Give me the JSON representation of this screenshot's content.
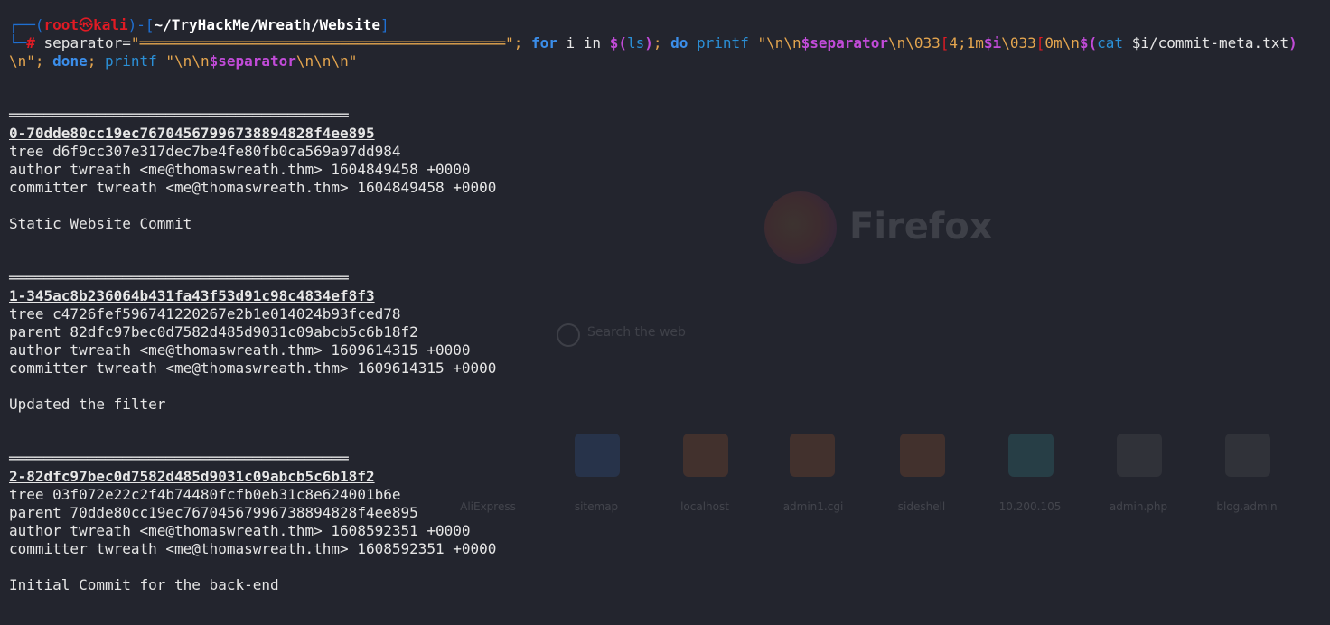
{
  "prompt": {
    "corner_top": "┌──(",
    "user": "root",
    "at_symbol": "㉿",
    "host": "kali",
    "mid": ")-[",
    "path": "~/TryHackMe/Wreath/Website",
    "close": "]",
    "corner_bottom": "└─",
    "hash": "#"
  },
  "command": {
    "part1": " separator=",
    "sep_string": "\"══════════════════════════════════════════\"",
    "semi1": "; ",
    "for_kw": "for",
    "i_in": " i in ",
    "sub_open": "$(",
    "ls": "ls",
    "sub_close": ")",
    "semi2": "; ",
    "do_kw": "do",
    "printf1": " printf ",
    "str1": "\"\\n\\n",
    "var_sep": "$separator",
    "str2": "\\n\\033",
    "bracket": "[",
    "str3": "4;1m",
    "var_i": "$i",
    "str4": "\\033",
    "bracket2": "[",
    "str5": "0m\\n",
    "sub2_open": "$(",
    "cat": "cat",
    "cat_arg": " $i/commit-meta.txt",
    "sub2_close": ")",
    "line2_str": "\\n\"",
    "semi3": "; ",
    "done_kw": "done",
    "semi4": ";",
    "printf2": " printf ",
    "str6": "\"\\n\\n",
    "var_sep2": "$separator",
    "str7": "\\n\\n\\n\""
  },
  "separator": "═══════════════════════════════════════",
  "commits": [
    {
      "header": "0-70dde80cc19ec76704567996738894828f4ee895",
      "lines": [
        "tree d6f9cc307e317dec7be4fe80fb0ca569a97dd984",
        "author twreath <me@thomaswreath.thm> 1604849458 +0000",
        "committer twreath <me@thomaswreath.thm> 1604849458 +0000"
      ],
      "message": "Static Website Commit"
    },
    {
      "header": "1-345ac8b236064b431fa43f53d91c98c4834ef8f3",
      "lines": [
        "tree c4726fef596741220267e2b1e014024b93fced78",
        "parent 82dfc97bec0d7582d485d9031c09abcb5c6b18f2",
        "author twreath <me@thomaswreath.thm> 1609614315 +0000",
        "committer twreath <me@thomaswreath.thm> 1609614315 +0000"
      ],
      "message": "Updated the filter"
    },
    {
      "header": "2-82dfc97bec0d7582d485d9031c09abcb5c6b18f2",
      "lines": [
        "tree 03f072e22c2f4b74480fcfb0eb31c8e624001b6e",
        "parent 70dde80cc19ec76704567996738894828f4ee895",
        "author twreath <me@thomaswreath.thm> 1608592351 +0000",
        "committer twreath <me@thomaswreath.thm> 1608592351 +0000"
      ],
      "message": "Initial Commit for the back-end"
    }
  ],
  "background": {
    "brand": "Firefox",
    "search_text": "Search the web",
    "tiles": [
      "AliExpress",
      "sitemap",
      "localhost",
      "admin1.cgi",
      "sideshell",
      "10.200.105",
      "admin.php",
      "blog.admin"
    ]
  },
  "colors": {
    "background": "#23252e",
    "prompt_frame": "#1f6fd1",
    "user_host": "#e01b24",
    "keyword": "#3b8eea",
    "string": "#e5a64f",
    "variable": "#c14bd8"
  }
}
